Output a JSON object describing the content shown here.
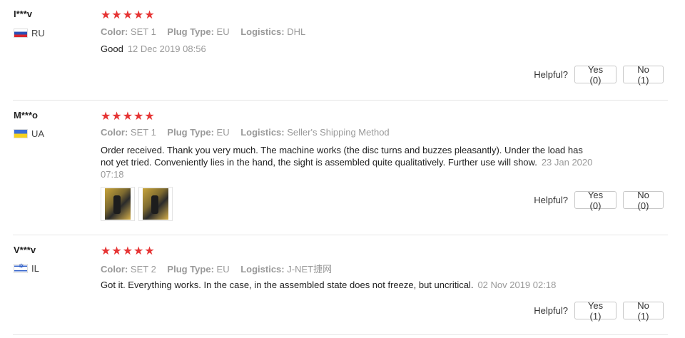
{
  "labels": {
    "color": "Color:",
    "plug_type": "Plug Type:",
    "logistics": "Logistics:",
    "helpful": "Helpful?"
  },
  "reviews": [
    {
      "user": "I***v",
      "country": "RU",
      "rating": "★★★★★",
      "color": "SET 1",
      "plug_type": "EU",
      "logistics": "DHL",
      "text": "Good",
      "date": "12 Dec 2019 08:56",
      "yes": "Yes (0)",
      "no": "No (1)"
    },
    {
      "user": "M***o",
      "country": "UA",
      "rating": "★★★★★",
      "color": "SET 1",
      "plug_type": "EU",
      "logistics": "Seller's Shipping Method",
      "text": "Order received. Thank you very much. The machine works (the disc turns and buzzes pleasantly). Under the load has not yet tried. Conveniently lies in the hand, the sight is assembled quite qualitatively. Further use will show.",
      "date": "23 Jan 2020 07:18",
      "yes": "Yes (0)",
      "no": "No (0)"
    },
    {
      "user": "V***v",
      "country": "IL",
      "rating": "★★★★★",
      "color": "SET 2",
      "plug_type": "EU",
      "logistics": "J-NET捷网",
      "text": "Got it. Everything works. In the case, in the assembled state does not freeze, but uncritical.",
      "date": "02 Nov 2019 02:18",
      "yes": "Yes (1)",
      "no": "No (1)"
    }
  ]
}
